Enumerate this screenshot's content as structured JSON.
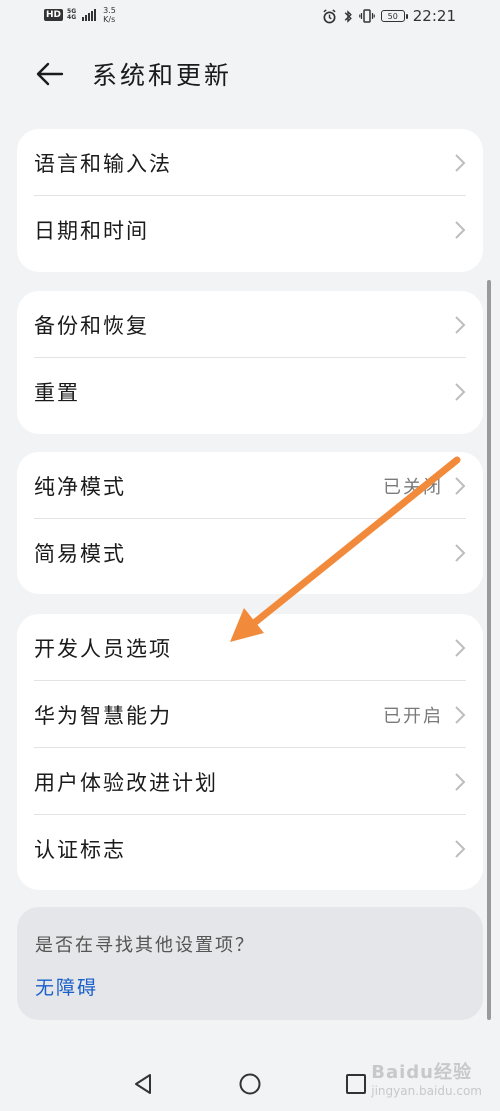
{
  "status_bar": {
    "hd": "HD",
    "network": "5G",
    "network_sub": "4G",
    "speed_value": "3.5",
    "speed_unit": "K/s",
    "battery": "50",
    "time": "22:21"
  },
  "header": {
    "title": "系统和更新"
  },
  "groups": [
    {
      "items": [
        {
          "label": "语言和输入法"
        },
        {
          "label": "日期和时间"
        }
      ]
    },
    {
      "items": [
        {
          "label": "备份和恢复"
        },
        {
          "label": "重置"
        }
      ]
    },
    {
      "items": [
        {
          "label": "纯净模式",
          "value": "已关闭"
        },
        {
          "label": "简易模式"
        }
      ]
    },
    {
      "items": [
        {
          "label": "开发人员选项"
        },
        {
          "label": "华为智慧能力",
          "value": "已开启"
        },
        {
          "label": "用户体验改进计划"
        },
        {
          "label": "认证标志"
        }
      ]
    }
  ],
  "suggestion": {
    "question": "是否在寻找其他设置项？",
    "link": "无障碍"
  },
  "watermark": {
    "brand": "Baidu经验",
    "sub": "jingyan.baidu.com"
  },
  "colors": {
    "background": "#f1f3f5",
    "card": "#ffffff",
    "link": "#1a5fc9",
    "arrow": "#f28a3c"
  }
}
